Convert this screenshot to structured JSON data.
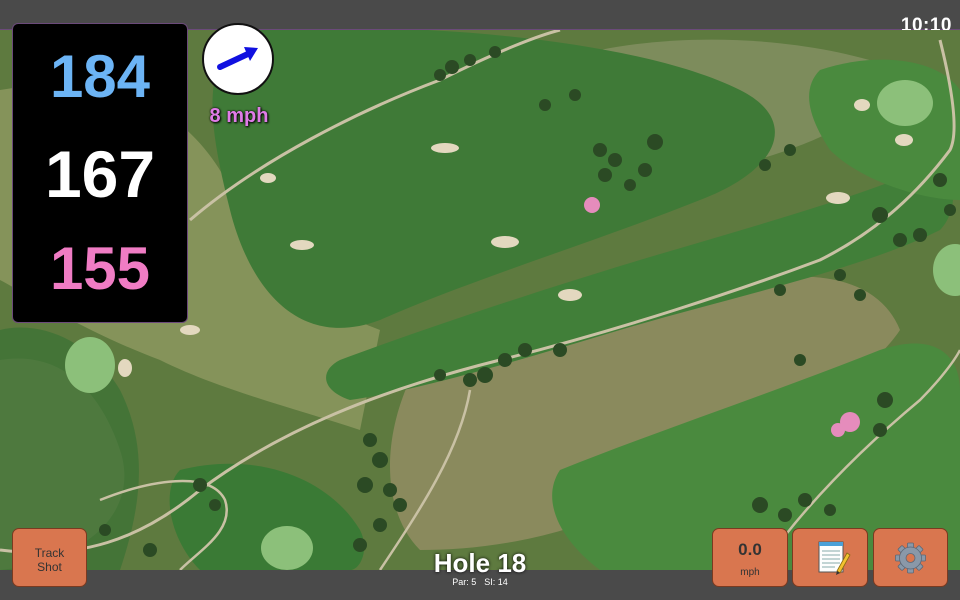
{
  "status_bar": {
    "time": "10:10"
  },
  "yardages": {
    "back": {
      "value": "184",
      "color": "#6cb4f5"
    },
    "middle": {
      "value": "167",
      "color": "#ffffff"
    },
    "front": {
      "value": "155",
      "color": "#f07cc4"
    }
  },
  "wind": {
    "speed": "8 mph",
    "arrow_icon": "arrow-icon",
    "speed_color": "#e07ce8"
  },
  "buttons": {
    "track_shot": {
      "line1": "Track",
      "line2": "Shot"
    },
    "speed": {
      "value": "0.0",
      "unit": "mph"
    },
    "notes_icon": "notepad-icon",
    "settings_icon": "gear-icon"
  },
  "hole": {
    "title": "Hole 18",
    "par": "Par: 5",
    "si": "SI: 14"
  },
  "colors": {
    "button_bg": "#d9764f",
    "panel_bg": "#000000",
    "bar_bg": "#4a4a4a"
  }
}
